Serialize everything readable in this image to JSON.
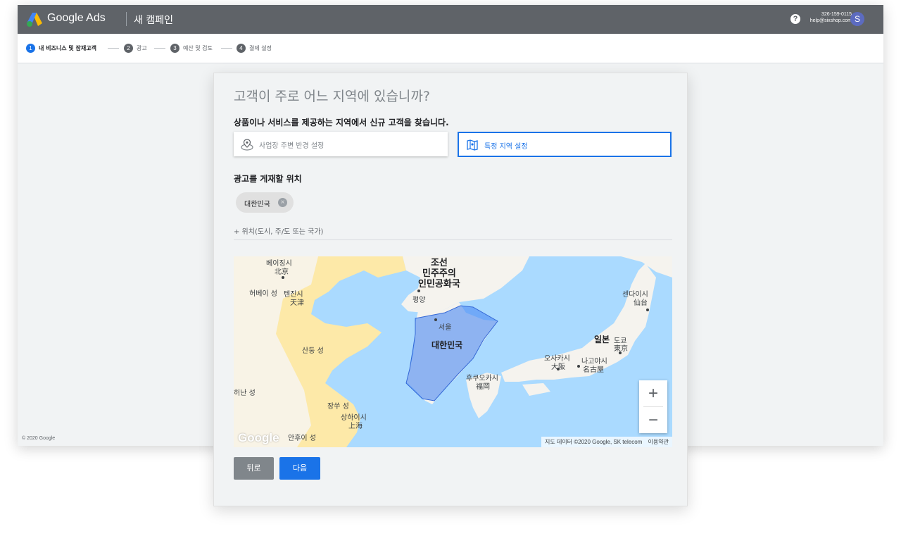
{
  "header": {
    "brand": "Google Ads",
    "campaign_title": "새 캠페인",
    "help_icon": "?",
    "phone": "326-159-0115",
    "email": "help@sixshop.com",
    "avatar_initial": "S"
  },
  "steps": [
    {
      "num": "1",
      "label": "내 비즈니스 및 잠재고객",
      "active": true
    },
    {
      "num": "2",
      "label": "광고",
      "active": false
    },
    {
      "num": "3",
      "label": "예산 및 검토",
      "active": false
    },
    {
      "num": "4",
      "label": "결제 설정",
      "active": false
    }
  ],
  "footer": {
    "copyright": "© 2020 Google"
  },
  "dialog": {
    "title": "고객이 주로 어느 지역에 있습니까?",
    "subtitle": "상품이나 서비스를 제공하는 지역에서 신규 고객을 찾습니다.",
    "options": [
      {
        "label": "사업장 주변 반경 설정",
        "icon": "radius-pin-icon",
        "selected": false
      },
      {
        "label": "특정 지역 설정",
        "icon": "map-icon",
        "selected": true
      }
    ],
    "locations_label": "광고를 게재할 위치",
    "chips": [
      {
        "label": "대한민국"
      }
    ],
    "add_location": "+ 위치(도시, 주/도 또는 국가)",
    "back_button": "뒤로",
    "next_button": "다음"
  },
  "map": {
    "labels": {
      "beijing_kr": "베이징시",
      "beijing_cn": "北京",
      "hebei": "허베이 성",
      "tianjin_kr": "텐진시",
      "tianjin_cn": "天津",
      "nk1": "조선",
      "nk2": "민주주의",
      "nk3": "인민공화국",
      "pyongyang": "평양",
      "seoul": "서울",
      "south_korea": "대한민국",
      "shandong": "산둥 성",
      "henan": "허난 성",
      "jiangsu": "장쑤 성",
      "shanghai_kr": "상하이시",
      "shanghai_cn": "上海",
      "anhui": "안후이 성",
      "fukuoka_kr": "후쿠오카시",
      "fukuoka_jp": "福岡",
      "osaka_kr": "오사카시",
      "osaka_jp": "大阪",
      "nagoya_kr": "나고야시",
      "nagoya_jp": "名古屋",
      "japan": "일본",
      "tokyo_kr": "도쿄",
      "tokyo_jp": "東京",
      "sendai_kr": "센다이시",
      "sendai_jp": "仙台"
    },
    "zoom_in": "+",
    "zoom_out": "−",
    "watermark": "Google",
    "attribution": "지도 데이터 ©2020 Google, SK telecom",
    "terms": "이용약관",
    "colors": {
      "water": "#aadaff",
      "land": "#f5f3ee",
      "selected_region": "#4a89f3"
    }
  }
}
